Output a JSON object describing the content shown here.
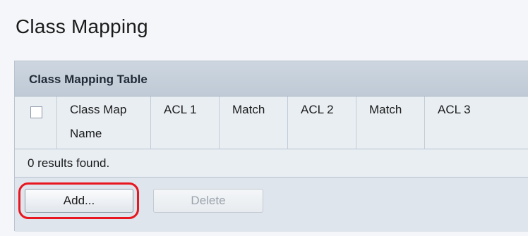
{
  "page": {
    "title": "Class Mapping"
  },
  "table": {
    "title": "Class Mapping Table",
    "columns": [
      {
        "line1": "",
        "line2": ""
      },
      {
        "line1": "Class Map",
        "line2": "Name"
      },
      {
        "line1": "ACL 1",
        "line2": ""
      },
      {
        "line1": "Match",
        "line2": ""
      },
      {
        "line1": "ACL 2",
        "line2": ""
      },
      {
        "line1": "Match",
        "line2": ""
      },
      {
        "line1": "ACL 3",
        "line2": ""
      }
    ],
    "results_text": "0 results found."
  },
  "buttons": {
    "add_label": "Add...",
    "delete_label": "Delete"
  },
  "colors": {
    "highlight": "#e8161f",
    "panel_bg": "#dfe5ec"
  }
}
